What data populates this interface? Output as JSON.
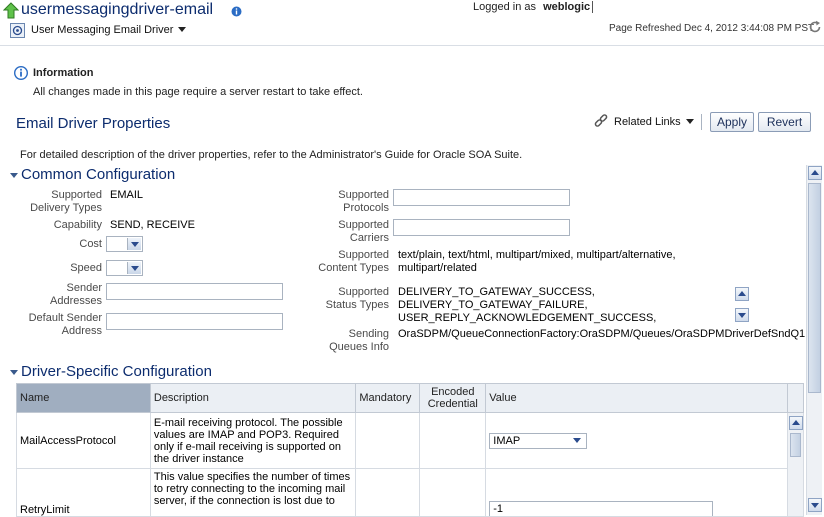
{
  "header": {
    "title": "usermessagingdriver-email",
    "logged_in_label": "Logged in as",
    "user": "weblogic",
    "menu_label": "User Messaging Email Driver",
    "refreshed": "Page Refreshed Dec 4, 2012 3:44:08 PM PST"
  },
  "info": {
    "title": "Information",
    "message": "All changes made in this page require a server restart to take effect."
  },
  "page": {
    "title": "Email Driver Properties",
    "related_links": "Related Links",
    "apply": "Apply",
    "revert": "Revert",
    "description": "For detailed description of the driver properties, refer to the Administrator's Guide for Oracle SOA Suite."
  },
  "common": {
    "title": "Common Configuration",
    "supported_delivery_types_l1": "Supported",
    "supported_delivery_types_l2": "Delivery Types",
    "supported_delivery_types_value": "EMAIL",
    "capability_label": "Capability",
    "capability_value": "SEND, RECEIVE",
    "cost_label": "Cost",
    "speed_label": "Speed",
    "sender_addresses_l1": "Sender",
    "sender_addresses_l2": "Addresses",
    "default_sender_l1": "Default Sender",
    "default_sender_l2": "Address",
    "supported_protocols_l1": "Supported",
    "supported_protocols_l2": "Protocols",
    "supported_carriers_l1": "Supported",
    "supported_carriers_l2": "Carriers",
    "content_types_l1": "Supported",
    "content_types_l2": "Content Types",
    "content_types_value_1": "text/plain, text/html, multipart/mixed, multipart/alternative,",
    "content_types_value_2": "multipart/related",
    "status_types_l1": "Supported",
    "status_types_l2": "Status Types",
    "status_types_values": [
      "DELIVERY_TO_GATEWAY_SUCCESS,",
      "DELIVERY_TO_GATEWAY_FAILURE,",
      "USER_REPLY_ACKNOWLEDGEMENT_SUCCESS,"
    ],
    "sending_queues_l1": "Sending",
    "sending_queues_l2": "Queues Info",
    "sending_queues_value": "OraSDPM/QueueConnectionFactory:OraSDPM/Queues/OraSDPMDriverDefSndQ1"
  },
  "driver": {
    "title": "Driver-Specific Configuration",
    "columns": [
      "Name",
      "Description",
      "Mandatory",
      "Encoded Credential",
      "Value"
    ],
    "rows": [
      {
        "name": "MailAccessProtocol",
        "description": "E-mail receiving protocol. The possible values are IMAP and POP3. Required only if e-mail receiving is supported on the driver instance",
        "value": "IMAP"
      },
      {
        "name": "RetryLimit",
        "description": "This value specifies the number of times to retry connecting to the incoming mail server, if the connection is lost due to",
        "value": "-1"
      }
    ]
  },
  "colors": {
    "title_blue": "#0c2c6e",
    "label_gray": "#4a4a4a",
    "header_selected": "#a0aec0",
    "info_icon": "#2b6cc4",
    "green_arrow": "#3a9a2a"
  }
}
